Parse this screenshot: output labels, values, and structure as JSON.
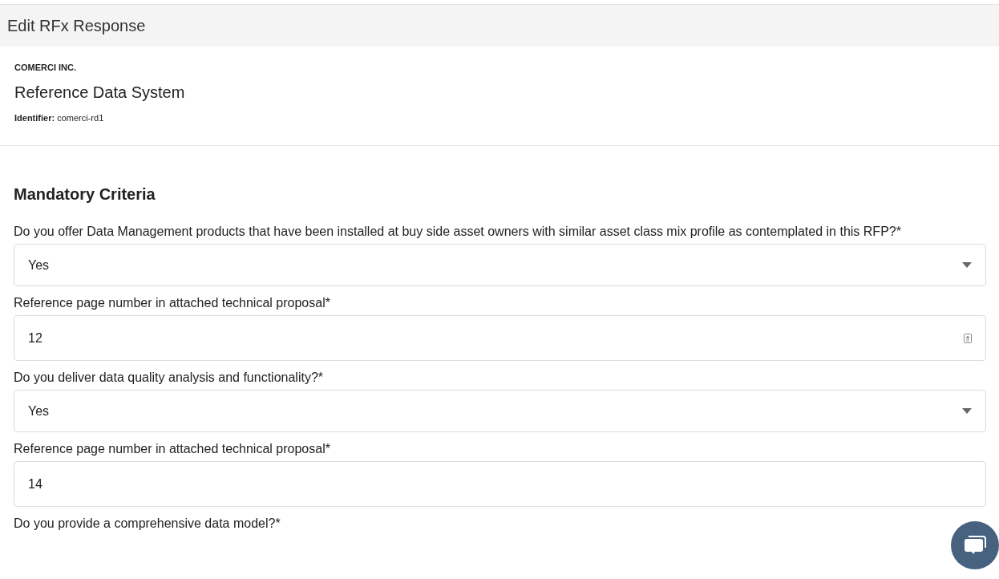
{
  "header": {
    "title": "Edit RFx Response"
  },
  "vendor": {
    "company": "COMERCI INC.",
    "product": "Reference Data System",
    "identifier_label": "Identifier:",
    "identifier_value": "comerci-rd1"
  },
  "section": {
    "title": "Mandatory Criteria"
  },
  "questions": [
    {
      "kind": "select",
      "label": "Do you offer Data Management products that have been installed at buy side asset owners with similar asset class mix profile as contemplated in this RFP?*",
      "value": "Yes"
    },
    {
      "kind": "number",
      "label": "Reference page number in attached technical proposal*",
      "value": "12"
    },
    {
      "kind": "select",
      "label": "Do you deliver data quality analysis and functionality?*",
      "value": "Yes"
    },
    {
      "kind": "number",
      "label": "Reference page number in attached technical proposal*",
      "value": "14"
    },
    {
      "kind": "label",
      "label": "Do you provide a comprehensive data model?*"
    }
  ]
}
